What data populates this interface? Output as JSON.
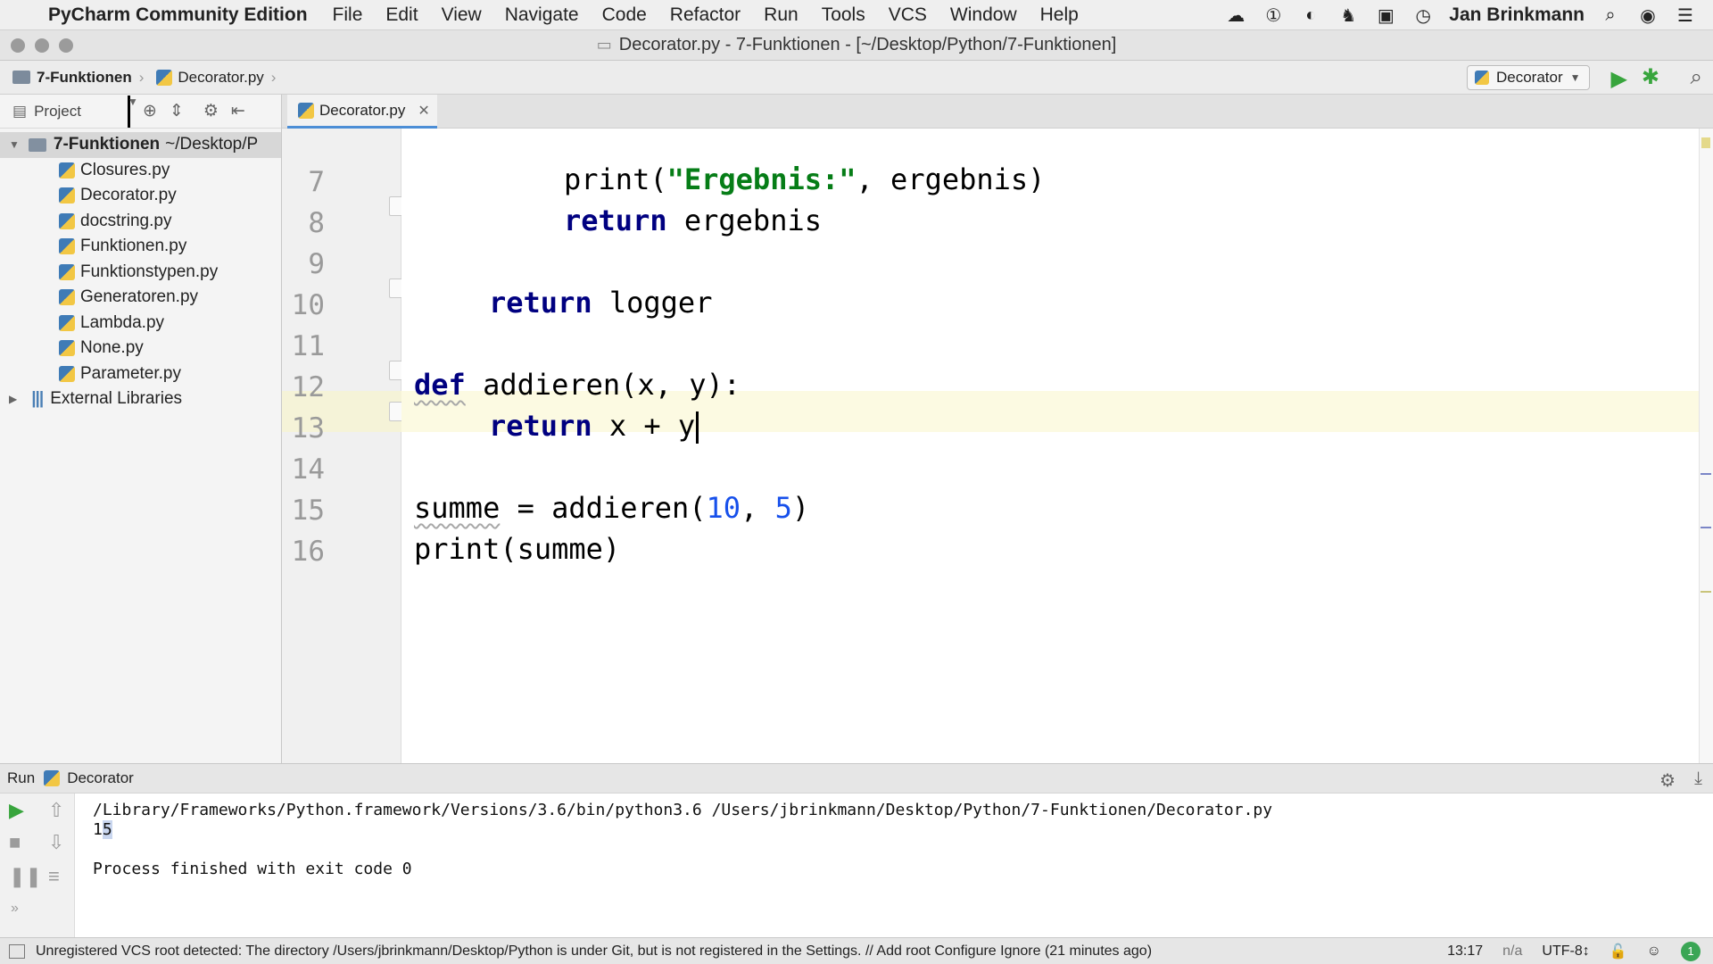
{
  "menubar": {
    "app_name": "PyCharm Community Edition",
    "items": [
      "File",
      "Edit",
      "View",
      "Navigate",
      "Code",
      "Refactor",
      "Run",
      "Tools",
      "VCS",
      "Window",
      "Help"
    ],
    "user": "Jan Brinkmann",
    "tray_icons": [
      "creative-cloud-icon",
      "1password-icon",
      "dashlane-icon",
      "ghost-icon",
      "screen-record-icon",
      "time-machine-icon"
    ]
  },
  "titlebar": {
    "title": "Decorator.py - 7-Funktionen - [~/Desktop/Python/7-Funktionen]"
  },
  "navbar": {
    "breadcrumb": [
      "7-Funktionen",
      "Decorator.py"
    ],
    "run_config": "Decorator"
  },
  "project": {
    "label": "Project",
    "root_name": "7-Funktionen",
    "root_path": "~/Desktop/P",
    "files": [
      "Closures.py",
      "Decorator.py",
      "docstring.py",
      "Funktionen.py",
      "Funktionstypen.py",
      "Generatoren.py",
      "Lambda.py",
      "None.py",
      "Parameter.py"
    ],
    "external": "External Libraries"
  },
  "editor": {
    "active_tab": "Decorator.py",
    "line_numbers": [
      "7",
      "8",
      "9",
      "10",
      "11",
      "12",
      "13",
      "14",
      "15",
      "16"
    ],
    "code": {
      "l7_fn": "print(",
      "l7_str": "\"Ergebnis:\"",
      "l7_rest": ", ergebnis)",
      "l8_kw": "return",
      "l8_rest": " ergebnis",
      "l10_kw": "return",
      "l10_rest": " logger",
      "l12_kw": "def",
      "l12_rest": " addieren(x, y):",
      "l13_kw": "return",
      "l13_rest": " x + y",
      "l15_a": "summe",
      "l15_b": " = addieren(",
      "l15_n1": "10",
      "l15_c": ", ",
      "l15_n2": "5",
      "l15_d": ")",
      "l16": "print(summe)"
    }
  },
  "run": {
    "label": "Run",
    "config": "Decorator",
    "command": "/Library/Frameworks/Python.framework/Versions/3.6/bin/python3.6 /Users/jbrinkmann/Desktop/Python/7-Funktionen/Decorator.py",
    "output_a": "1",
    "output_b": "5",
    "finished": "Process finished with exit code 0"
  },
  "status": {
    "message": "Unregistered VCS root detected: The directory /Users/jbrinkmann/Desktop/Python is under Git, but is not registered in the Settings. // Add root  Configure  Ignore (21 minutes ago)",
    "position": "13:17",
    "na": "n/a",
    "encoding": "UTF-8↕",
    "badge": "1"
  }
}
